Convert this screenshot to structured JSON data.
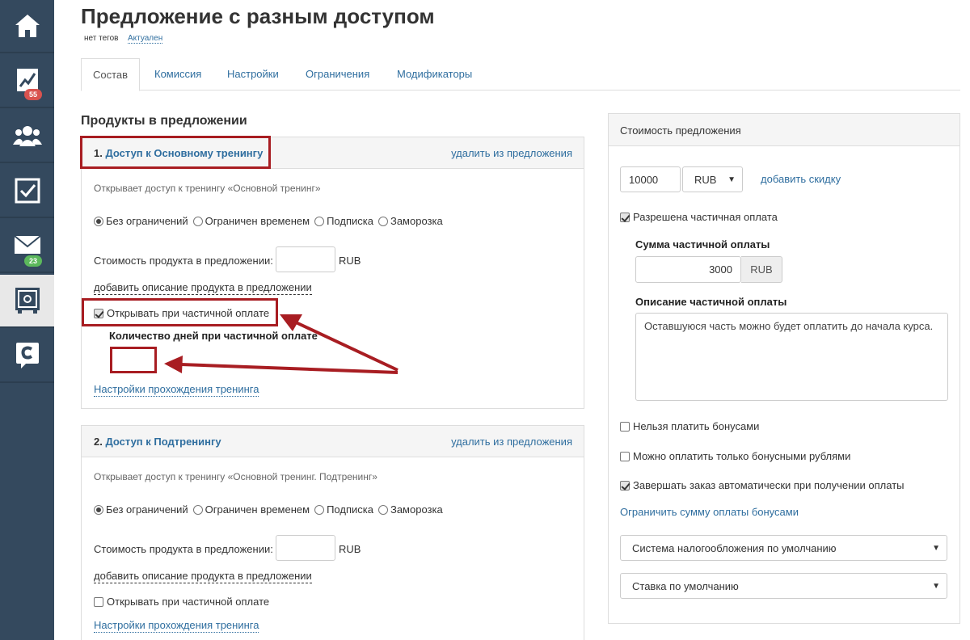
{
  "header": {
    "title": "Предложение с разным доступом",
    "tags": "нет тегов",
    "status": "Актуален"
  },
  "sidebar": {
    "items": [
      {
        "icon": "home-icon"
      },
      {
        "icon": "chart-icon",
        "badge": "55"
      },
      {
        "icon": "users-icon"
      },
      {
        "icon": "tasks-icon"
      },
      {
        "icon": "mail-icon",
        "badge": "23"
      },
      {
        "icon": "safe-icon"
      },
      {
        "icon": "chat-icon"
      }
    ]
  },
  "tabs": [
    "Состав",
    "Комиссия",
    "Настройки",
    "Ограничения",
    "Модификаторы"
  ],
  "section_title": "Продукты в предложении",
  "products": [
    {
      "number": "1.",
      "name": "Доступ к Основному тренингу",
      "remove": "удалить из предложения",
      "description": "Открывает доступ к тренингу «Основной тренинг»",
      "radios": [
        "Без ограничений",
        "Ограничен временем",
        "Подписка",
        "Заморозка"
      ],
      "price_label": "Стоимость продукта в предложении:",
      "price_value": "",
      "currency": "RUB",
      "add_description": "добавить описание продукта в предложении",
      "partial_label": "Открывать при частичной оплате",
      "partial_checked": true,
      "days_label": "Количество дней при частичной оплате",
      "settings_link": "Настройки прохождения тренинга"
    },
    {
      "number": "2.",
      "name": "Доступ к Подтренингу",
      "remove": "удалить из предложения",
      "description": "Открывает доступ к тренингу «Основной тренинг. Подтренинг»",
      "radios": [
        "Без ограничений",
        "Ограничен временем",
        "Подписка",
        "Заморозка"
      ],
      "price_label": "Стоимость продукта в предложении:",
      "price_value": "",
      "currency": "RUB",
      "add_description": "добавить описание продукта в предложении",
      "partial_label": "Открывать при частичной оплате",
      "partial_checked": false,
      "settings_link": "Настройки прохождения тренинга"
    }
  ],
  "pricing": {
    "title": "Стоимость предложения",
    "price": "10000",
    "currency": "RUB",
    "add_discount": "добавить скидку",
    "partial_allowed": "Разрешена частичная оплата",
    "partial_sum_label": "Сумма частичной оплаты",
    "partial_sum": "3000",
    "partial_currency": "RUB",
    "partial_desc_label": "Описание частичной оплаты",
    "partial_desc": "Оставшуюся часть можно будет оплатить до начала курса.",
    "no_bonus": "Нельзя платить бонусами",
    "only_bonus": "Можно оплатить только бонусными рублями",
    "auto_complete": "Завершать заказ автоматически при получении оплаты",
    "limit_bonus": "Ограничить сумму оплаты бонусами",
    "tax_system": "Система налогообложения по умолчанию",
    "tax_rate": "Ставка по умолчанию"
  },
  "colors": {
    "sidebar": "#34495e",
    "link": "#2f6e9f",
    "highlight": "#a81d22"
  }
}
